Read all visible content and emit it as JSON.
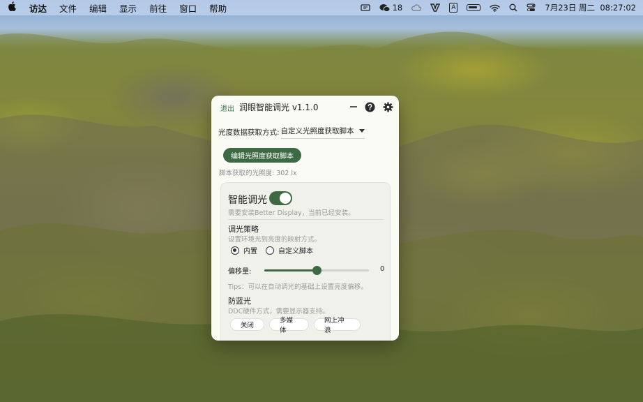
{
  "menubar": {
    "app_name": "访达",
    "menus": [
      "文件",
      "编辑",
      "显示",
      "前往",
      "窗口",
      "帮助"
    ],
    "wechat_badge": "18",
    "input_method": "A",
    "datetime": "7月23日 周二  08:27:02"
  },
  "window": {
    "quit_label": "退出",
    "title": "润眼智能调光 v1.1.0",
    "accent_color": "#3e6a43"
  },
  "source": {
    "label": "光度数据获取方式:",
    "selected": "自定义光照度获取脚本"
  },
  "edit_button_label": "编辑光照度获取脚本",
  "lux_text": "脚本获取的光照度: 302 lx",
  "smart": {
    "title": "智能调光",
    "enabled": true,
    "subtitle": "需要安装Better Display，当前已经安装。"
  },
  "strategy": {
    "title": "调光策略",
    "subtitle": "设置环境光到亮度的映射方式。",
    "options": [
      "内置",
      "自定义脚本"
    ],
    "selected_index": 0
  },
  "offset": {
    "label": "偏移量:",
    "value": "0",
    "slider_fraction": 0.5
  },
  "tips": "Tips：可以在自动调光的基础上设置亮度偏移。",
  "blue_light": {
    "title": "防蓝光",
    "subtitle": "DDC硬件方式，需要显示器支持。",
    "buttons": [
      "关闭",
      "多媒体",
      "网上冲浪"
    ]
  }
}
